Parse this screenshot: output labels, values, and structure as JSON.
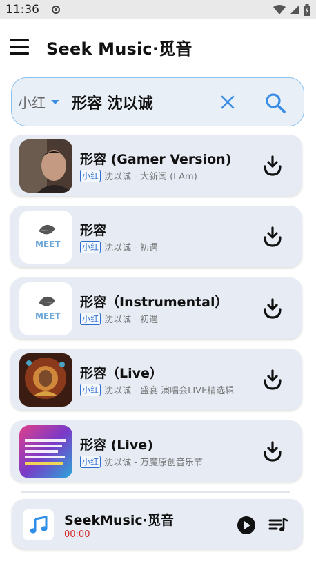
{
  "status_bar": {
    "time": "11:36"
  },
  "header": {
    "title": "Seek Music·觅音"
  },
  "search": {
    "source": "小红",
    "query": "形容 沈以诚"
  },
  "results": [
    {
      "title": "形容 (Gamer Version)",
      "source": "小红",
      "artist_album": "沈以诚 - 大新闻 (I Am)"
    },
    {
      "title": "形容",
      "source": "小红",
      "artist_album": "沈以诚 - 初遇"
    },
    {
      "title": "形容（Instrumental）",
      "source": "小红",
      "artist_album": "沈以诚 - 初遇"
    },
    {
      "title": "形容（Live）",
      "source": "小红",
      "artist_album": "沈以诚 - 盛宴 演唱会LIVE精选辑"
    },
    {
      "title": "形容 (Live)",
      "source": "小红",
      "artist_album": "沈以诚 - 万魔原创音乐节"
    }
  ],
  "player": {
    "title": "SeekMusic·觅音",
    "time": "00:00"
  },
  "colors": {
    "accent": "#3a8ee6",
    "card_bg": "#e6ebf4",
    "time_red": "#d32f2f",
    "badge_blue": "#2e6fd0"
  }
}
